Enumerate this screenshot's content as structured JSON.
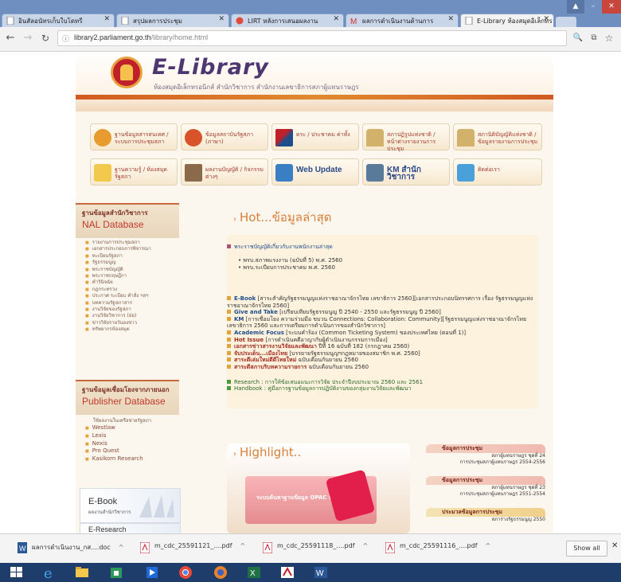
{
  "browser": {
    "tabs": [
      {
        "title": "อินสัลอนัทรเก็บใบโดทรี",
        "active": false
      },
      {
        "title": "สรุปผลการประชุม",
        "active": false
      },
      {
        "title": "LIRT หลังการเสนอผลงาน",
        "active": false
      },
      {
        "title": "ผลการดำเนินงานด้านการ",
        "active": false
      },
      {
        "title": "E-Library ห้องสมุดอิเล็กทร",
        "active": true
      }
    ],
    "url_host": "library2.parliament.go.th",
    "url_path": "/library/home.html",
    "info_icon_label": "ⓘ"
  },
  "site": {
    "title": "E-Library",
    "subtitle": "ห้องสมุดอิเล็กทรอนิกส์  สำนักวิชาการ  สำนักงานเลขาธิการสภาผู้แทนราษฎร",
    "quick_links": [
      {
        "label": "ฐานข้อมูลสารสนเทศ / ระบบการประชุมสภา"
      },
      {
        "label": "ข้อมูลสถาบันรัฐสภา (ภาษา)"
      },
      {
        "label": "ตระ / ประชาคม ค่าทั้ง"
      },
      {
        "label": "สภาปฏิรูปแห่งชาติ / หน้าต่างรายงานการประชุม"
      },
      {
        "label": "สภานิติบัญญัติแห่งชาติ / ข้อมูลรายงานการประชุม"
      },
      {
        "label": "ฐานความรู้ / ห้องสมุดรัฐสภา"
      },
      {
        "label": "ผลงานบัญญัติ / กิจกรรมต่างๆ"
      },
      {
        "label": "Web Update"
      },
      {
        "label": "KM สำนักวิชาการ"
      },
      {
        "label": "ติดต่อเรา"
      }
    ],
    "nal": {
      "title_th": "ฐานข้อมูลสำนักวิชาการ",
      "title_en": "NAL Database",
      "items": [
        "รายงานการประชุมสภา",
        "เอกสารประกอบการพิจารณา",
        "ทะเบียนรัฐสภา",
        "รัฐธรรมนูญ",
        "พระราชบัญญัติ",
        "พระราชกฤษฎีกา",
        "คำวินิจฉัย",
        "กฎกระทรวง",
        "ประกาศ ระเบียบ คำสั่ง ฯลฯ",
        "บทความรัฐสภาสาร",
        "งานวิจัยของรัฐสภา",
        "งานวิจัยวิชาการ (ย่อ)",
        "ข่าววิจัยรายวันลงข่าว",
        "ทรัพยากรห้องสมุด"
      ]
    },
    "publisher": {
      "title_th": "ฐานข้อมูลเชื่อมโยงจากภายนอก",
      "title_en": "Publisher Database",
      "note": "ใช้ผลงานในเครือข่ายรัฐสภา",
      "items": [
        "Westlaw",
        "Lexis",
        "Nexis",
        "Pro Quest",
        "Kasikorn Research"
      ]
    },
    "hot": {
      "title": "Hot...ข้อมูลล่าสุด",
      "law_heading": "พระราชบัญญัติเกี่ยวกับงานพนักงานล่าสุด",
      "law_items": [
        "พรบ.สภาพแรงงาน (ฉบับที่ 5) พ.ศ. 2560",
        "พรบ.ระเบียบการประชาคม พ.ศ. 2560"
      ],
      "entries": [
        {
          "label": "E-Book",
          "text": "[สาระสำคัญรัฐธรรมนูญแห่งราชอาณาจักรไทย เลขาธิการ 2560][เอกสารประกอบนิทรรศการ เรื่อง รัฐธรรมนูญแห่งราชอาณาจักรไทย 2560]"
        },
        {
          "label": "Give and Take",
          "text": "[เปรียบเทียบรัฐธรรมนูญ ปี 2540 - 2550 และรัฐธรรมนูญ ปี 2560]"
        },
        {
          "label": "KM",
          "text": "[การเชื่อมโยง ความร่วมมือ ขบวน Connections: Collaboration: Community][รัฐธรรมนูญแห่งราชอาณาจักรไทย เลขาธิการ 2560 และการเตรียมการดำเนินการของสำนักวิชาการ]"
        },
        {
          "label": "Academic Focus",
          "text": "[ระบบคำร้อง (Common Ticketing System) ของประเทศไทย (ตอนที่ 1)]"
        },
        {
          "label": "Hot Issue",
          "text": "[การดำเนินคดีอาญากับผู้ดำเนินงานกรรมการเมือง]"
        },
        {
          "label": "เอกสารข่าวสารงานวิจัยและพัฒนา",
          "text": "ปีที่ 16 ฉบับที่ 182 (กรกฎาคม 2560)"
        },
        {
          "label": "จับประเด็น...เมืองไทย",
          "text": "[บรรยายรัฐธรรมนูญฯกฎหมายของสมาชิก พ.ศ. 2560]"
        },
        {
          "label": "สาระดีเล่มใหม่ดีดีไทยใหม่",
          "text": "ฉบับเดือนกันยายน 2560"
        },
        {
          "label": "สาระดีสภาบริบทความรายการ",
          "text": "ฉบับเดือนกันยายน 2560"
        }
      ],
      "research_items": [
        "Research : การให้ข้อเสนอแนะการวิจัย ประจำปีงบประมาณ 2560 และ 2561",
        "Handbook : คู่มือการฐานข้อมูลการปฏิบัติงานของกลุ่มงานวิจัยและพัฒนา"
      ]
    },
    "highlight": {
      "title": "Highlight..",
      "opac_label": "ระบบค้นหาฐานข้อมูล OPAC SEARCH"
    },
    "side_news": [
      {
        "badge": "ข้อมูลการประชุม",
        "line1": "สภาผู้แทนราษฎร ชุดที่ 24",
        "line2": "การประชุมสภาผู้แทนราษฎร 2554-2556"
      },
      {
        "badge": "ข้อมูลการประชุม",
        "line1": "สภาผู้แทนราษฎร ชุดที่ 23",
        "line2": "การประชุมสภาผู้แทนราษฎร 2551-2554"
      },
      {
        "badge": "ประมวลข้อมูลการประชุม",
        "line1": "สภาร่างรัฐธรรมนูญ 2550",
        "line2": ""
      }
    ],
    "ebook_label": "E-Book",
    "ebook_sub": "ผลงานสำนักวิชาการ",
    "eresearch_label": "E-Research"
  },
  "downloads": [
    {
      "name": "ผลการดำเนินงาน_กส....doc",
      "icon": "word-doc-icon"
    },
    {
      "name": "m_cdc_25591121_....pdf",
      "icon": "pdf-icon"
    },
    {
      "name": "m_cdc_25591118_....pdf",
      "icon": "pdf-icon"
    },
    {
      "name": "m_cdc_25591116_....pdf",
      "icon": "pdf-icon"
    }
  ],
  "show_all_label": "Show all",
  "colors": {
    "title_purple": "#4e3670",
    "accent_orange": "#d8803a",
    "header_red": "#c0392b",
    "taskbar": "#1f3d6b"
  }
}
